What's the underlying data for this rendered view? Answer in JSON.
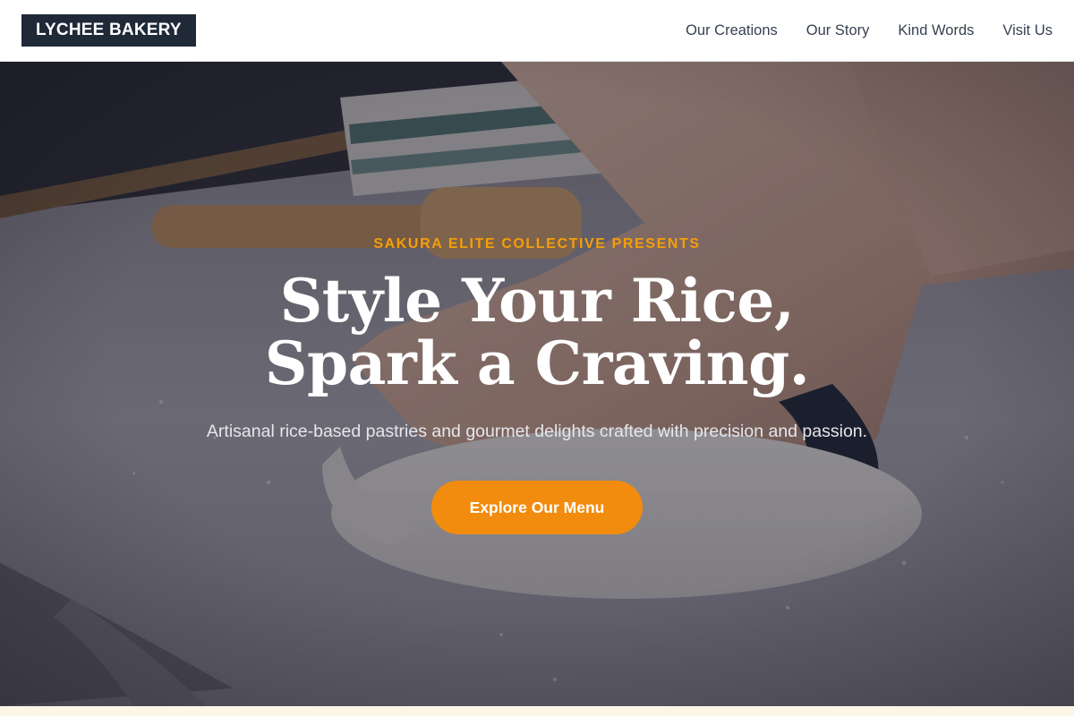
{
  "header": {
    "logo": "LYCHEE BAKERY",
    "nav": [
      {
        "label": "Our Creations"
      },
      {
        "label": "Our Story"
      },
      {
        "label": "Kind Words"
      },
      {
        "label": "Visit Us"
      }
    ]
  },
  "hero": {
    "eyebrow": "SAKURA ELITE COLLECTIVE PRESENTS",
    "headline_line1": "Style Your Rice,",
    "headline_line2": "Spark a Craving.",
    "subtitle": "Artisanal rice-based pastries and gourmet delights crafted with precision and passion.",
    "cta_label": "Explore Our Menu"
  },
  "colors": {
    "logo_bg": "#1f2937",
    "accent": "#f28c0f",
    "eyebrow": "#f59e0b"
  }
}
